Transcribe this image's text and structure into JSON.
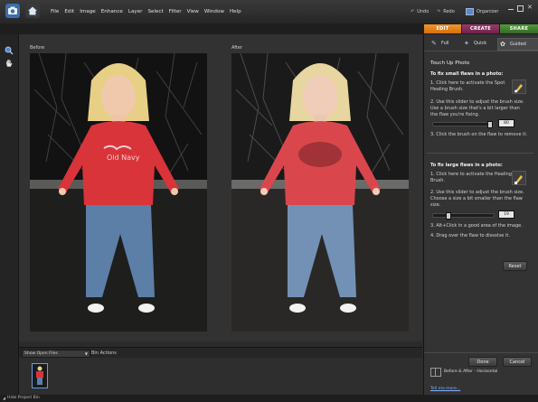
{
  "menu": {
    "items": [
      "File",
      "Edit",
      "Image",
      "Enhance",
      "Layer",
      "Select",
      "Filter",
      "View",
      "Window",
      "Help"
    ]
  },
  "topbar": {
    "undo": "Undo",
    "redo": "Redo",
    "organizer": "Organizer"
  },
  "mode_tabs": {
    "edit": "EDIT",
    "create": "CREATE",
    "share": "SHARE"
  },
  "canvas": {
    "before_label": "Before",
    "after_label": "After"
  },
  "panel": {
    "tabs": {
      "full": "Full",
      "quick": "Quick",
      "guided": "Guided"
    },
    "title": "Touch Up Photo",
    "small": {
      "heading": "To fix small flaws in a photo:",
      "step1": "1. Click here to activate the Spot Healing Brush.",
      "step2": "2. Use this slider to adjust the brush size. Use a brush size that's a bit larger than the flaw you're fixing.",
      "size_value": "80",
      "step3": "3. Click the brush on the flaw to remove it."
    },
    "large": {
      "heading": "To fix large flaws in a photo:",
      "step1": "1. Click here to activate the Healing Brush.",
      "step2": "2. Use this slider to adjust the brush size. Choose a size a bit smaller than the flaw size.",
      "size_value": "19",
      "step3": "3. Alt+Click in a good area of the image.",
      "step4": "4. Drag over the flaw to dissolve it."
    },
    "reset": "Reset",
    "done": "Done",
    "cancel": "Cancel",
    "view_option": "Before & After - Horizontal",
    "tell_me_more": "Tell me more..."
  },
  "bin": {
    "show_select": "Show Open Files",
    "bin_actions": "Bin Actions"
  },
  "status": {
    "hide_project_bin": "Hide Project Bin"
  },
  "colors": {
    "edit_tab": "#e07b10",
    "create_tab": "#7d2a55",
    "share_tab": "#3f7a2c",
    "shirt": "#d8343a",
    "jeans": "#5c7fa8",
    "link": "#7fb0ff"
  }
}
